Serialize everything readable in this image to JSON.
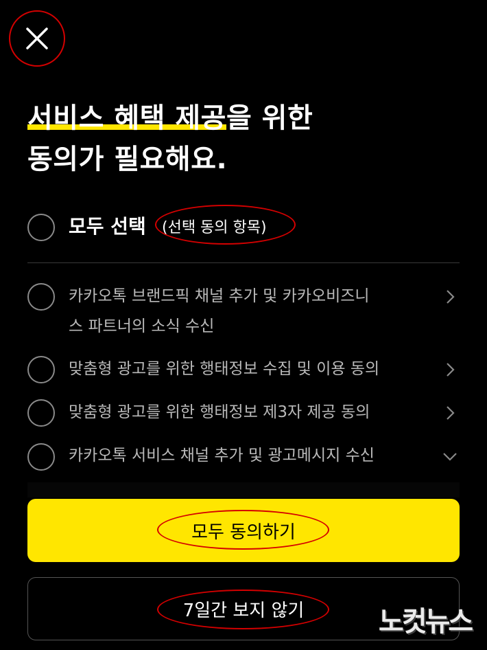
{
  "headline": {
    "highlight": "서비스 혜택 제공",
    "line1_rest": "을 위한",
    "line2": "동의가 필요해요."
  },
  "select_all": {
    "label": "모두 선택",
    "sub_label": "(선택 동의 항목)"
  },
  "items": [
    {
      "line1": "카카오톡 브랜드픽 채널 추가 및 카카오비즈니",
      "line2": "스 파트너의 소식 수신",
      "chevron": "chevron-right-icon"
    },
    {
      "line1": "맞춤형 광고를 위한 행태정보 수집 및 이용 동의",
      "chevron": "chevron-right-icon"
    },
    {
      "line1": "맞춤형 광고를 위한 행태정보 제3자 제공 동의",
      "chevron": "chevron-right-icon"
    },
    {
      "line1": "카카오톡 서비스 채널 추가 및 광고메시지 수신",
      "chevron": "chevron-down-icon"
    }
  ],
  "buttons": {
    "agree_all": "모두 동의하기",
    "skip_7days": "7일간 보지 않기"
  },
  "watermark": "노컷뉴스",
  "colors": {
    "background": "#000000",
    "accent_yellow": "#ffe600",
    "annotation_red": "#d40000",
    "item_text": "#b9b9b9"
  }
}
